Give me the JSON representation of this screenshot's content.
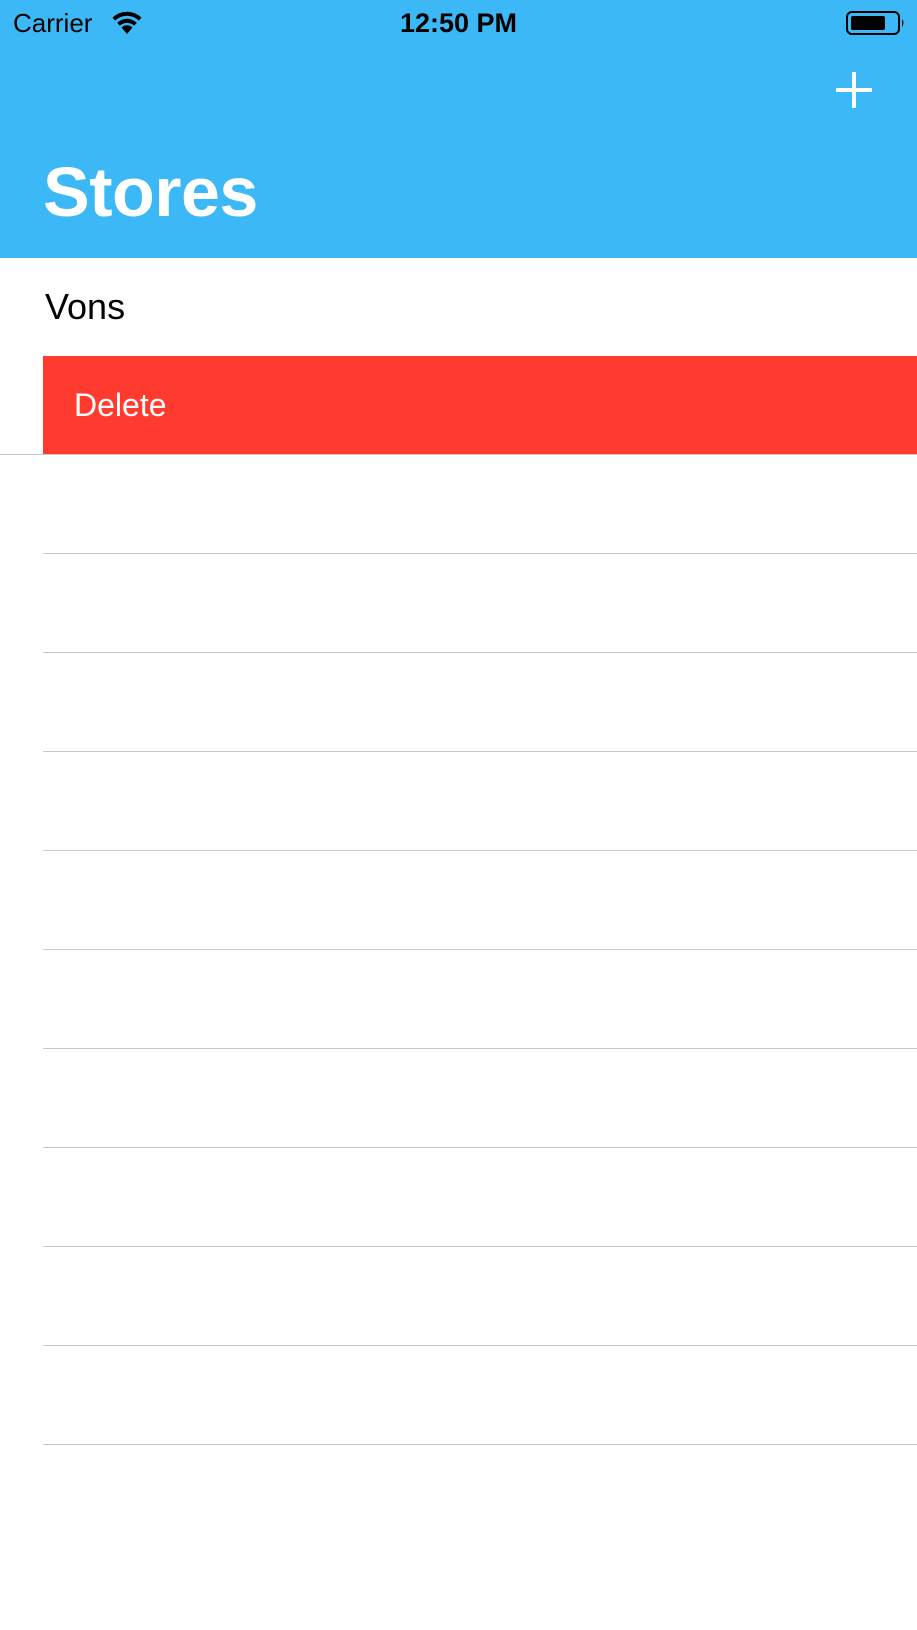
{
  "status_bar": {
    "carrier": "Carrier",
    "time": "12:50 PM",
    "wifi_icon": "wifi-icon",
    "battery_icon": "battery-icon"
  },
  "nav": {
    "title": "Stores",
    "add_icon": "plus-icon",
    "background_color": "#3db8f7"
  },
  "stores": [
    {
      "name": "Vons"
    }
  ],
  "swipe_action": {
    "label": "Delete",
    "color": "#ff3b30"
  }
}
